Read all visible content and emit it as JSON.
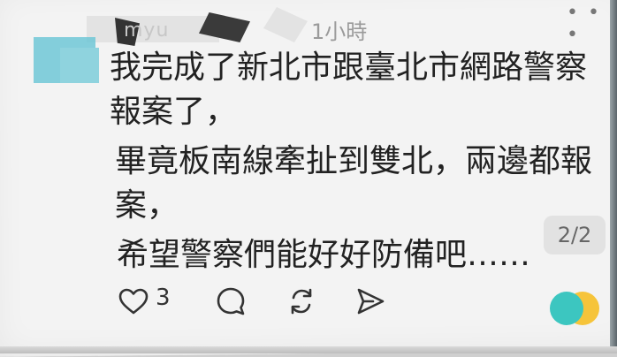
{
  "post": {
    "username_censored": "myu",
    "timestamp": "1小時",
    "lines": [
      "我完成了新北市跟臺北市網路警察",
      "報案了，",
      "畢竟板南線牽扯到雙北，兩邊都報",
      "案，",
      "希望警察們能好好防備吧……"
    ],
    "page_indicator": "2/2",
    "like_count": "3"
  },
  "icons": {
    "more": "more-icon",
    "like": "heart-icon",
    "reply": "comment-icon",
    "repost": "repost-icon",
    "share": "send-icon"
  },
  "colors": {
    "text": "#222222",
    "timestamp": "#9a9a9a",
    "accent_teal": "#3cc6c0",
    "accent_yellow": "#f6c43a"
  }
}
